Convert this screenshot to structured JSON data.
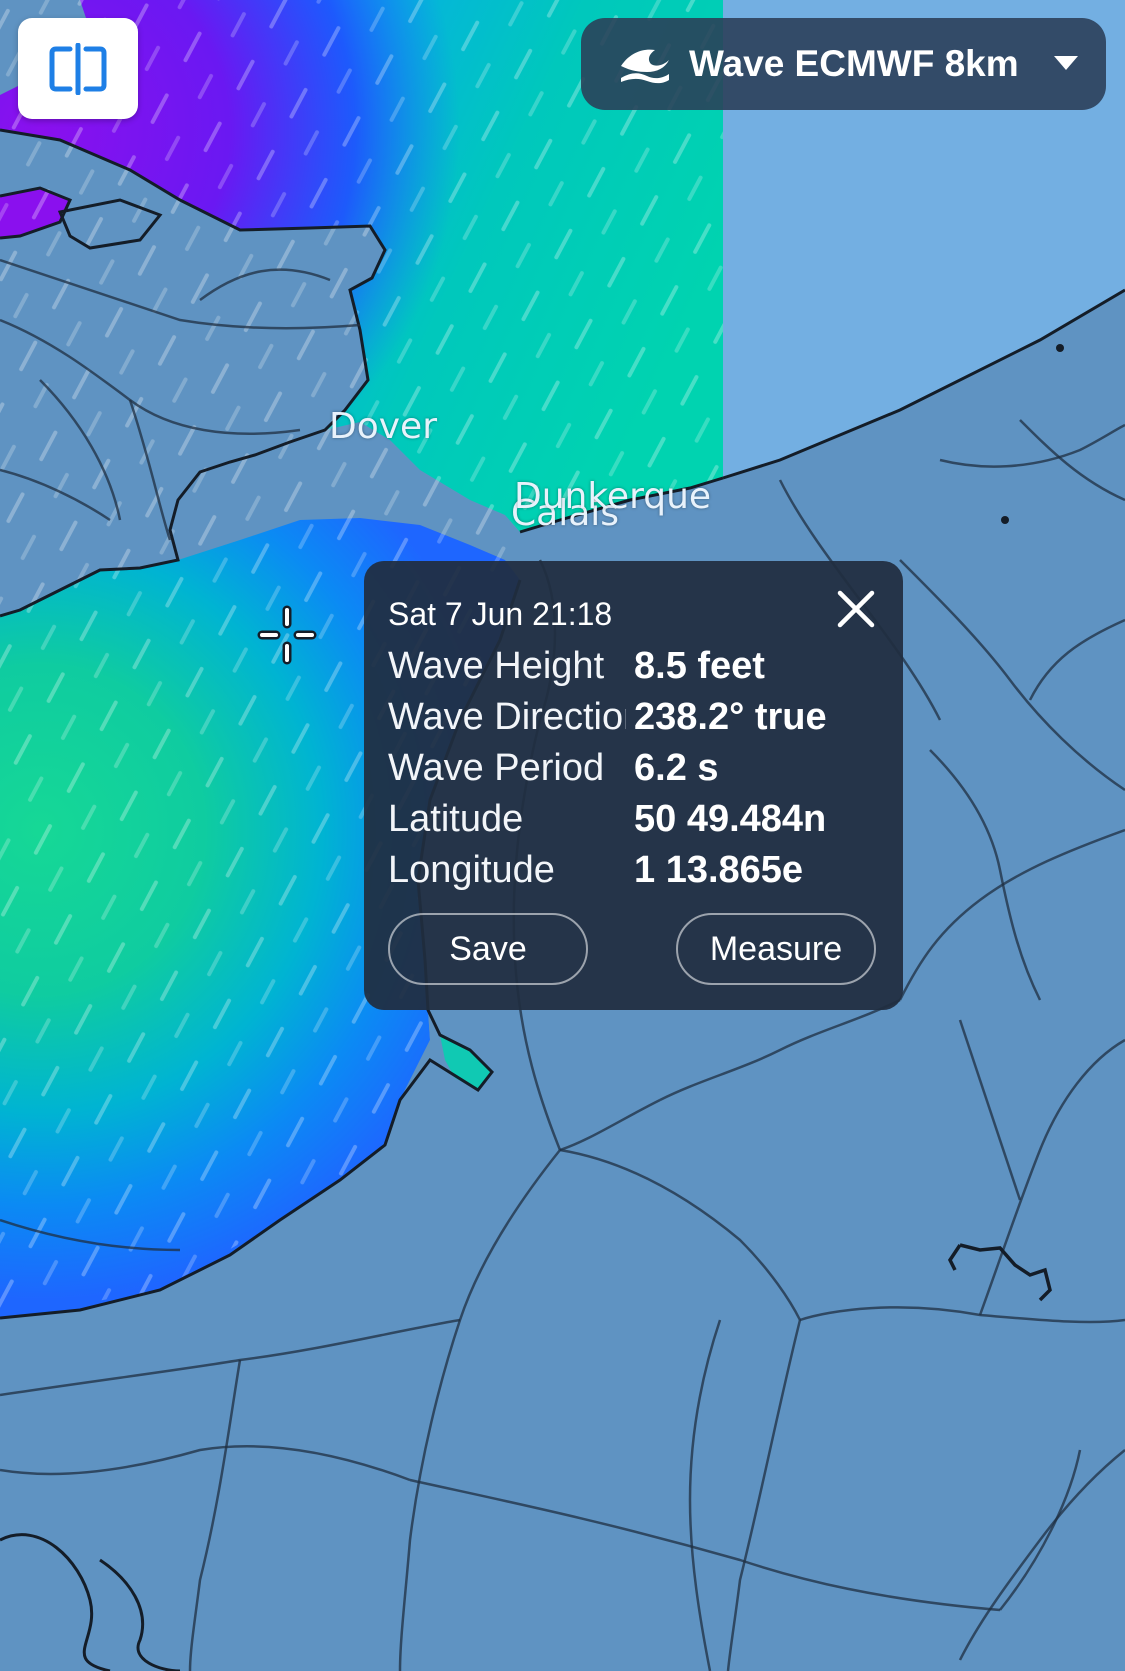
{
  "map": {
    "places": [
      {
        "name": "Dover"
      },
      {
        "name": "Calais"
      },
      {
        "name": "Dunkerque"
      }
    ],
    "colors": {
      "land": "#5f93c2",
      "land_light": "#73afe2",
      "coast": "#141d28",
      "wave_low": "#0a62ff",
      "wave_mid": "#00c7b6",
      "wave_high": "#10d88f",
      "wave_extreme": "#7a10f0"
    }
  },
  "app_logo": {
    "icon": "split-map-icon",
    "color": "#1e7fe6"
  },
  "layer_selector": {
    "icon": "waves-icon",
    "label": "Wave ECMWF 8km",
    "dropdown_icon": "chevron-down-icon"
  },
  "popup": {
    "timestamp": "Sat 7 Jun 21:18",
    "rows": [
      {
        "label": "Wave Height",
        "value": "8.5 feet"
      },
      {
        "label": "Wave Direction",
        "value": "238.2° true"
      },
      {
        "label": "Wave Period",
        "value": "6.2 s"
      },
      {
        "label": "Latitude",
        "value": "50 49.484n"
      },
      {
        "label": "Longitude",
        "value": "1 13.865e"
      }
    ],
    "save_label": "Save",
    "measure_label": "Measure",
    "close_icon": "close-icon"
  }
}
